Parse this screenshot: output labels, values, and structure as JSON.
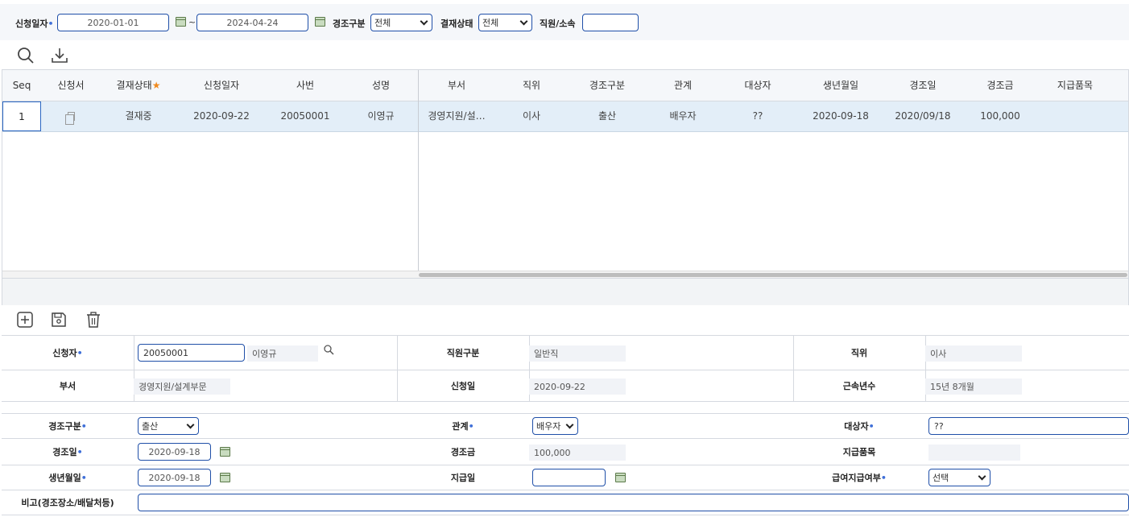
{
  "search": {
    "apply_date_label": "신청일자",
    "date_from": "2020-01-01",
    "tilde": "~",
    "date_to": "2024-04-24",
    "condolence_type_label": "경조구분",
    "condolence_type_value": "전체",
    "approval_status_label": "결재상태",
    "approval_status_value": "전체",
    "employee_label": "직원/소속",
    "employee_value": "",
    "required_mark": "•"
  },
  "toolbar": {
    "search_icon": "search-icon",
    "download_icon": "download-icon"
  },
  "grid": {
    "columns": [
      "Seq",
      "신청서",
      "결재상태",
      "신청일자",
      "사번",
      "성명",
      "부서",
      "직위",
      "경조구분",
      "관계",
      "대상자",
      "생년월일",
      "경조일",
      "경조금",
      "지급품목"
    ],
    "required_column_mark": "★",
    "rows": [
      {
        "seq": "1",
        "status": "결재중",
        "apply_date": "2020-09-22",
        "emp_no": "20050001",
        "name": "이영규",
        "dept": "경영지원/설…",
        "position": "이사",
        "type": "출산",
        "relation": "배우자",
        "target": "??",
        "birth": "2020-09-18",
        "event_date": "2020/09/18",
        "amount": "100,000",
        "item": ""
      }
    ]
  },
  "form_toolbar": {
    "add_icon": "plus-square-icon",
    "save_icon": "save-icon",
    "delete_icon": "trash-icon"
  },
  "form": {
    "applicant_label": "신청자",
    "applicant_no": "20050001",
    "applicant_name": "이영규",
    "emp_type_label": "직원구분",
    "emp_type_value": "일반직",
    "position_label": "직위",
    "position_value": "이사",
    "dept_label": "부서",
    "dept_value": "경영지원/설계부문",
    "apply_date_label": "신청일",
    "apply_date_value": "2020-09-22",
    "tenure_label": "근속년수",
    "tenure_value": "15년 8개월",
    "type_label": "경조구분",
    "type_value": "출산",
    "relation_label": "관계",
    "relation_value": "배우자",
    "target_label": "대상자",
    "target_value": "??",
    "event_date_label": "경조일",
    "event_date_value": "2020-09-18",
    "amount_label": "경조금",
    "amount_value": "100,000",
    "item_label": "지급품목",
    "item_value": "",
    "birth_label": "생년월일",
    "birth_value": "2020-09-18",
    "pay_date_label": "지급일",
    "pay_date_value": "",
    "salary_pay_label": "급여지급여부",
    "salary_pay_value": "선택",
    "remarks_label": "비고(경조장소/배달처등)",
    "remarks_value": ""
  }
}
